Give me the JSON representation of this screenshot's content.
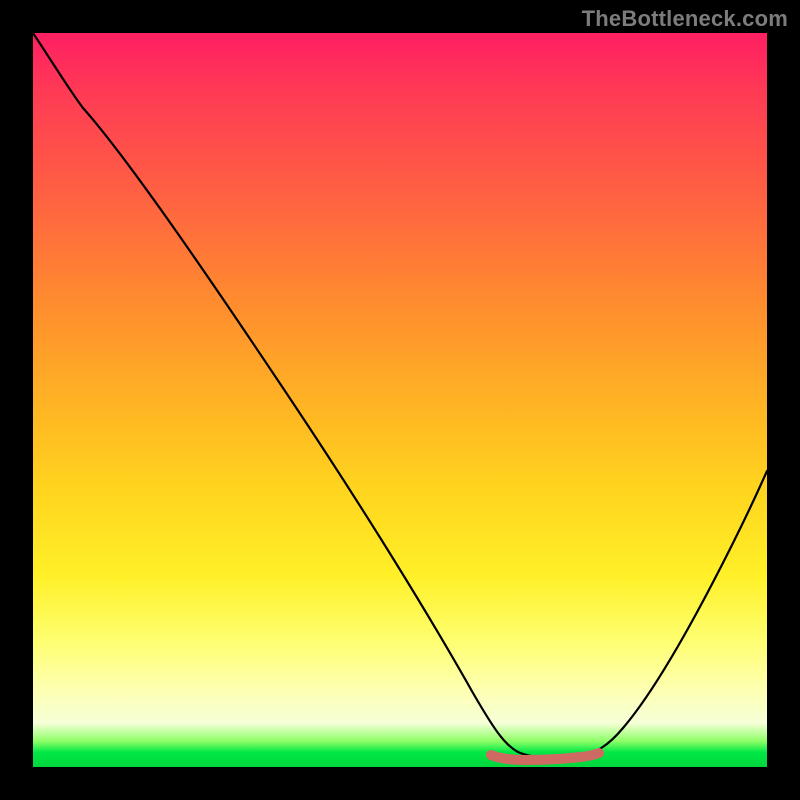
{
  "watermark": "TheBottleneck.com",
  "colors": {
    "frame_border": "#000000",
    "curve": "#000000",
    "flat_marker": "#cf6a62",
    "gradient_top": "#ff1f63",
    "gradient_mid": "#ffd41e",
    "gradient_bottom": "#00d63e"
  },
  "chart_data": {
    "type": "line",
    "title": "",
    "xlabel": "",
    "ylabel": "",
    "xlim": [
      0,
      100
    ],
    "ylim": [
      0,
      100
    ],
    "grid": false,
    "series": [
      {
        "name": "bottleneck-curve",
        "x": [
          0,
          6,
          12,
          20,
          28,
          36,
          44,
          52,
          58,
          62,
          66,
          70,
          74,
          80,
          88,
          96,
          100
        ],
        "values": [
          100,
          94,
          88,
          77,
          64,
          51,
          38,
          24,
          12,
          5,
          1,
          0,
          0,
          4,
          18,
          36,
          46
        ]
      }
    ],
    "annotations": [
      {
        "name": "optimal-flat-region",
        "x_start": 62,
        "x_end": 76,
        "y": 0.8
      }
    ]
  }
}
